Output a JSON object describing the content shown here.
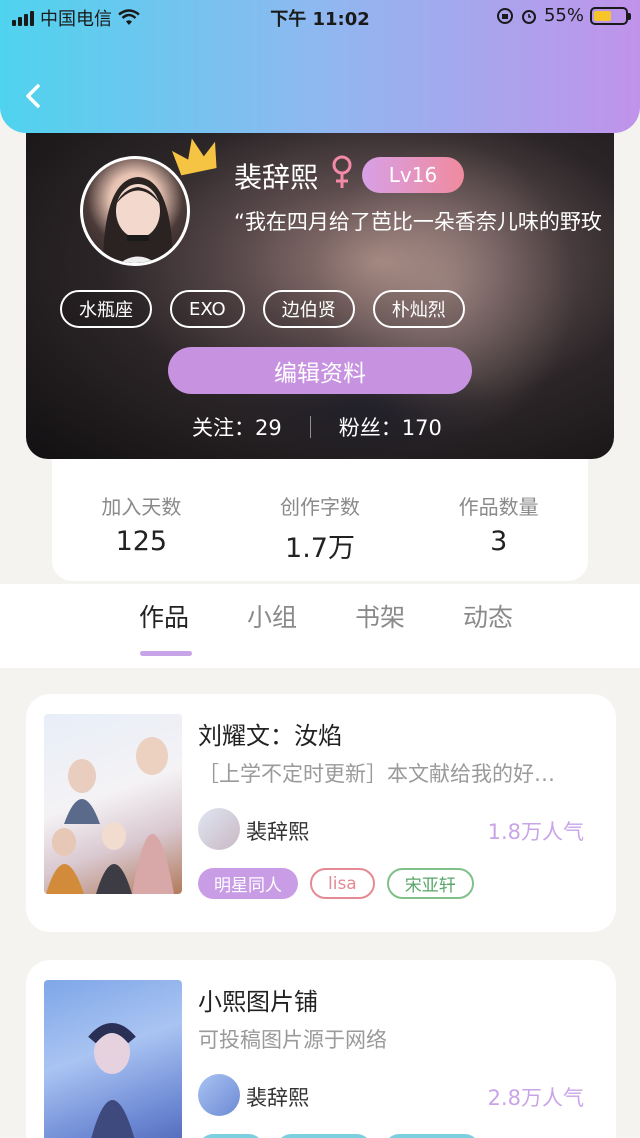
{
  "status_bar": {
    "carrier": "中国电信",
    "time": "下午 11:02",
    "battery_percent": "55%",
    "battery_level": 0.55
  },
  "profile": {
    "name": "裴辞熙",
    "level": "Lv16",
    "motto": "“我在四月给了芭比一朵香奈儿味的野玫",
    "tags": [
      "水瓶座",
      "EXO",
      "边伯贤",
      "朴灿烈"
    ],
    "edit_label": "编辑资料",
    "following_label": "关注：",
    "following_count": "29",
    "followers_label": "粉丝：",
    "followers_count": "170"
  },
  "stats": [
    {
      "label": "加入天数",
      "value": "125"
    },
    {
      "label": "创作字数",
      "value": "1.7万"
    },
    {
      "label": "作品数量",
      "value": "3"
    }
  ],
  "tabs": [
    {
      "label": "作品",
      "active": true
    },
    {
      "label": "小组",
      "active": false
    },
    {
      "label": "书架",
      "active": false
    },
    {
      "label": "动态",
      "active": false
    }
  ],
  "works": [
    {
      "title": "刘耀文：汝焰",
      "description": "［上学不定时更新］本文献给我的好…",
      "author": "裴辞熙",
      "popularity": "1.8万人气",
      "tags": [
        "明星同人",
        "lisa",
        "宋亚轩"
      ]
    },
    {
      "title": "小熙图片铺",
      "description": "可投稿图片源于网络",
      "author": "裴辞熙",
      "popularity": "2.8万人气",
      "tags": []
    }
  ],
  "colors": {
    "header_gradient": [
      "#4fd3ee",
      "#c093ea"
    ],
    "accent_purple": "#c793e0",
    "popularity": "#c9a4e8"
  }
}
